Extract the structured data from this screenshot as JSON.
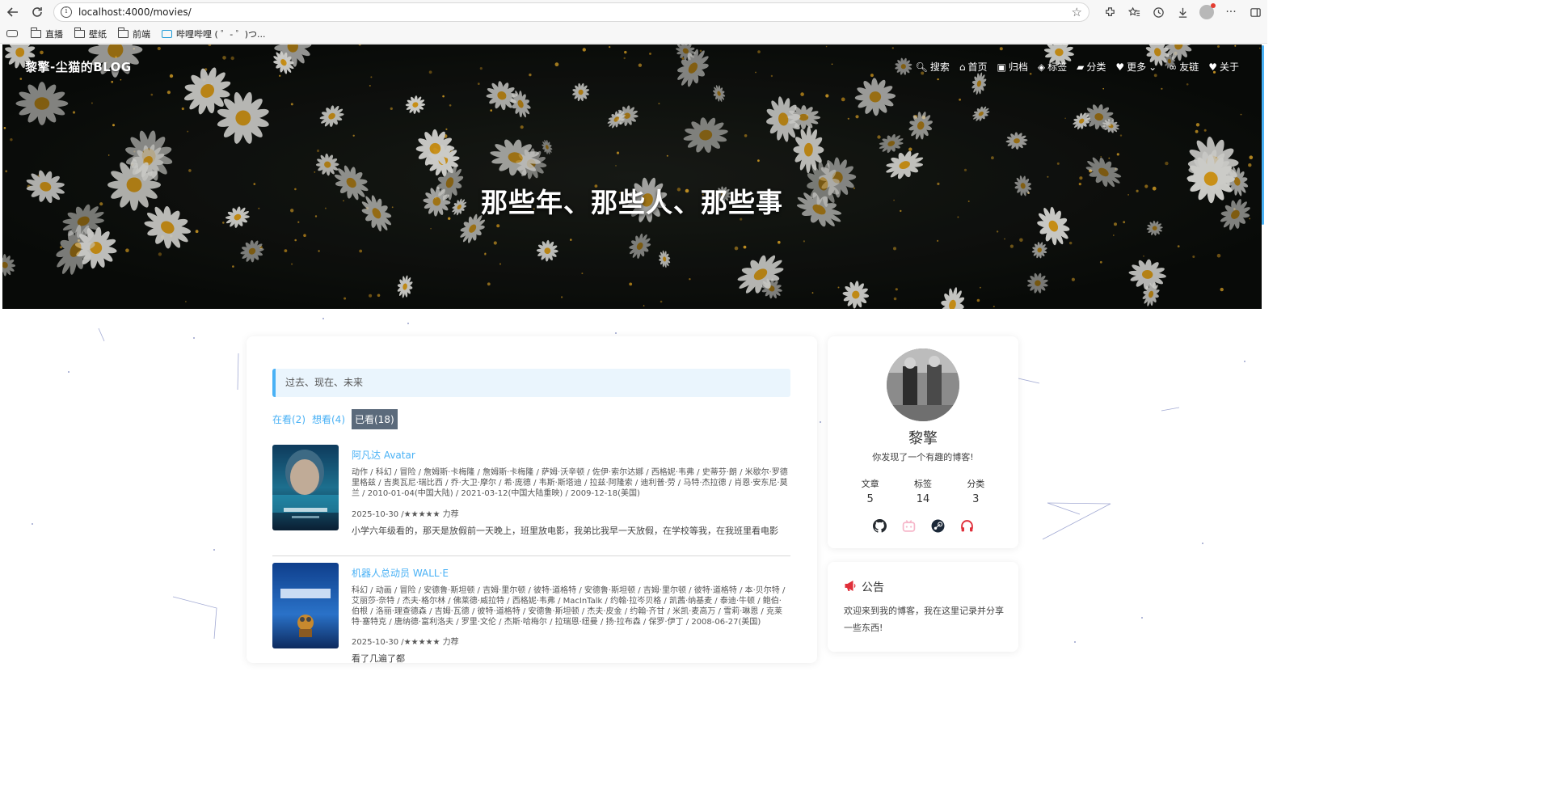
{
  "browser": {
    "url": "localhost:4000/movies/",
    "bookmarks": [
      {
        "label": "直播"
      },
      {
        "label": "壁纸"
      },
      {
        "label": "前端"
      },
      {
        "label": "哔哩哔哩 ( ゜- ゜)つ..."
      }
    ]
  },
  "header": {
    "brand": "黎擎-尘猫的BLOG",
    "menu": [
      {
        "label": "搜索",
        "icon": "search-icon"
      },
      {
        "label": "首页",
        "icon": "home-icon"
      },
      {
        "label": "归档",
        "icon": "archive-icon"
      },
      {
        "label": "标签",
        "icon": "tags-icon"
      },
      {
        "label": "分类",
        "icon": "folder-open-icon"
      },
      {
        "label": "更多",
        "icon": "heartbeat-icon"
      },
      {
        "label": "友链",
        "icon": "link-icon"
      },
      {
        "label": "关于",
        "icon": "heart-icon"
      }
    ],
    "title": "那些年、那些人、那些事"
  },
  "main": {
    "notice": "过去、现在、未来",
    "tabs": [
      {
        "label": "在看(2)"
      },
      {
        "label": "想看(4)"
      },
      {
        "label": "已看(18)",
        "active": true
      }
    ],
    "movies": [
      {
        "title": "阿凡达 Avatar",
        "meta": "动作 / 科幻 / 冒险 / 詹姆斯·卡梅隆 / 詹姆斯·卡梅隆 / 萨姆·沃辛顿 / 佐伊·索尔达娜 / 西格妮·韦弗 / 史蒂芬·朗 / 米歇尔·罗德里格兹 / 吉奥瓦尼·瑞比西 / 乔·大卫·摩尔 / 希·庞德 / 韦斯·斯塔迪 / 拉兹·阿隆索 / 迪利普·劳 / 马特·杰拉德 / 肖恩·安东尼·莫兰 / 2010-01-04(中国大陆) / 2021-03-12(中国大陆重映) / 2009-12-18(美国)",
        "date_rating": "2025-10-30 /★★★★★ 力荐",
        "comment": "小学六年级看的，那天是放假前一天晚上，班里放电影，我弟比我早一天放假，在学校等我，在我班里看电影"
      },
      {
        "title": "机器人总动员 WALL·E",
        "meta": "科幻 / 动画 / 冒险 / 安德鲁·斯坦顿 / 吉姆·里尔顿 / 彼特·道格特 / 安德鲁·斯坦顿 / 吉姆·里尔顿 / 彼特·道格特 / 本·贝尔特 / 艾丽莎·奈特 / 杰夫·格尔林 / 佛莱德·威拉特 / 西格妮·韦弗 / MacInTalk / 约翰·拉岑贝格 / 凯茜·纳基麦 / 泰迪·牛顿 / 鲍伯·伯根 / 洛丽·理查德森 / 吉姆·瓦德 / 彼特·道格特 / 安德鲁·斯坦顿 / 杰夫·皮金 / 约翰·齐甘 / 米凯·麦高万 / 雪莉·琳恩 / 克莱特·塞特克 / 唐纳德·富利洛夫 / 罗里·文伦 / 杰斯·哈梅尔 / 拉瑞恩·纽曼 / 扬·拉布森 / 保罗·伊丁 / 2008-06-27(美国)",
        "date_rating": "2025-10-30 /★★★★★ 力荐",
        "comment": "看了几遍了都"
      }
    ]
  },
  "profile": {
    "name": "黎擎",
    "description": "你发现了一个有趣的博客!",
    "stats": [
      {
        "label": "文章",
        "value": "5"
      },
      {
        "label": "标签",
        "value": "14"
      },
      {
        "label": "分类",
        "value": "3"
      }
    ],
    "socials": [
      {
        "icon": "github-icon",
        "color": "#24292e"
      },
      {
        "icon": "bilibili-icon",
        "color": "#f6b6c9"
      },
      {
        "icon": "steam-icon",
        "color": "#1b2838"
      },
      {
        "icon": "headphones-icon",
        "color": "#e02f3a"
      }
    ]
  },
  "announcement": {
    "title": "公告",
    "text": "欢迎来到我的博客，我在这里记录并分享一些东西!"
  }
}
